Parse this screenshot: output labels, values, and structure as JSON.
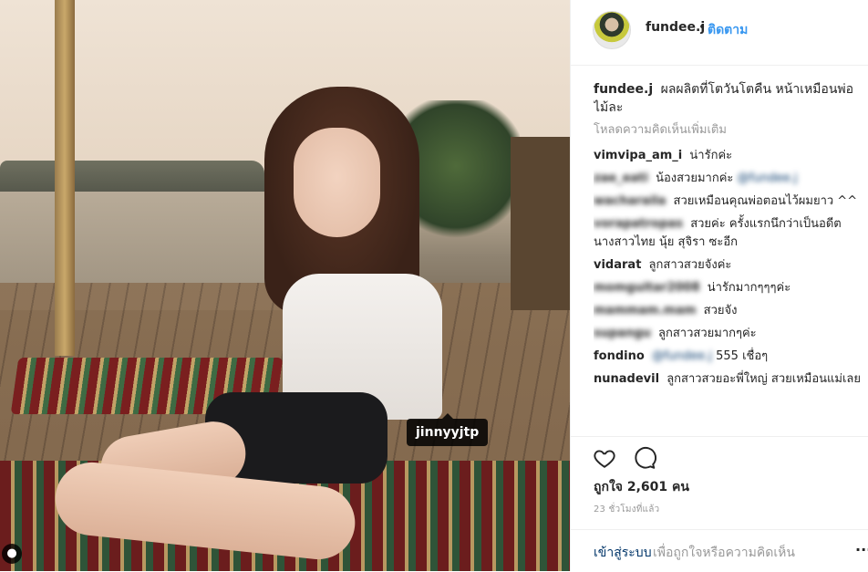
{
  "photo": {
    "tag_label": "jinnyyjtp",
    "user_tag_icon": "person-icon"
  },
  "header": {
    "username": "fundee.j",
    "separator": "•",
    "follow_label": "ติดตาม"
  },
  "caption": {
    "username": "fundee.j",
    "text": "ผลผลิตที่โตวันโตคืน หน้าเหมือนพ่อไม้ละ"
  },
  "load_more_label": "โหลดความคิดเห็นเพิ่มเติม",
  "comments": [
    {
      "user": "vimvipa_am_i",
      "text": "น่ารักค่ะ"
    },
    {
      "user": "zae_eati",
      "text": "น้องสวยมากค่ะ",
      "mention": "@fundee.j"
    },
    {
      "user": "wacharaila",
      "text": "สวยเหมือนคุณพ่อตอนไว้ผมยาว ^^"
    },
    {
      "user": "vorapatropas",
      "text": "สวยค่ะ ครั้งแรกนึกว่าเป็นอดีตนางสาวไทย นุ้ย สุจิรา ซะอีก"
    },
    {
      "user": "vidarat",
      "text": "ลูกสาวสวยจังค่ะ"
    },
    {
      "user": "momguitar2008",
      "text": "น่ารักมากๆๆๆค่ะ"
    },
    {
      "user": "mammam.mam",
      "text": "สวยจัง"
    },
    {
      "user": "supangu",
      "text": "ลูกสาวสวยมากๆค่ะ"
    },
    {
      "user": "fondino",
      "mention": "@fundee.j",
      "text": "555 เชื่อๆ"
    },
    {
      "user": "nunadevil",
      "text": "ลูกสาวสวยอะพี่ใหญ่ สวยเหมือนแม่เลย"
    }
  ],
  "likes_label": "ถูกใจ 2,601 คน",
  "timestamp": "23 ชั่วโมงที่แล้ว",
  "footer": {
    "login_label": "เข้าสู่ระบบ",
    "login_rest": "เพื่อถูกใจหรือความคิดเห็น",
    "more_label": "..."
  },
  "icons": {
    "like": "heart-icon",
    "comment": "comment-icon"
  }
}
